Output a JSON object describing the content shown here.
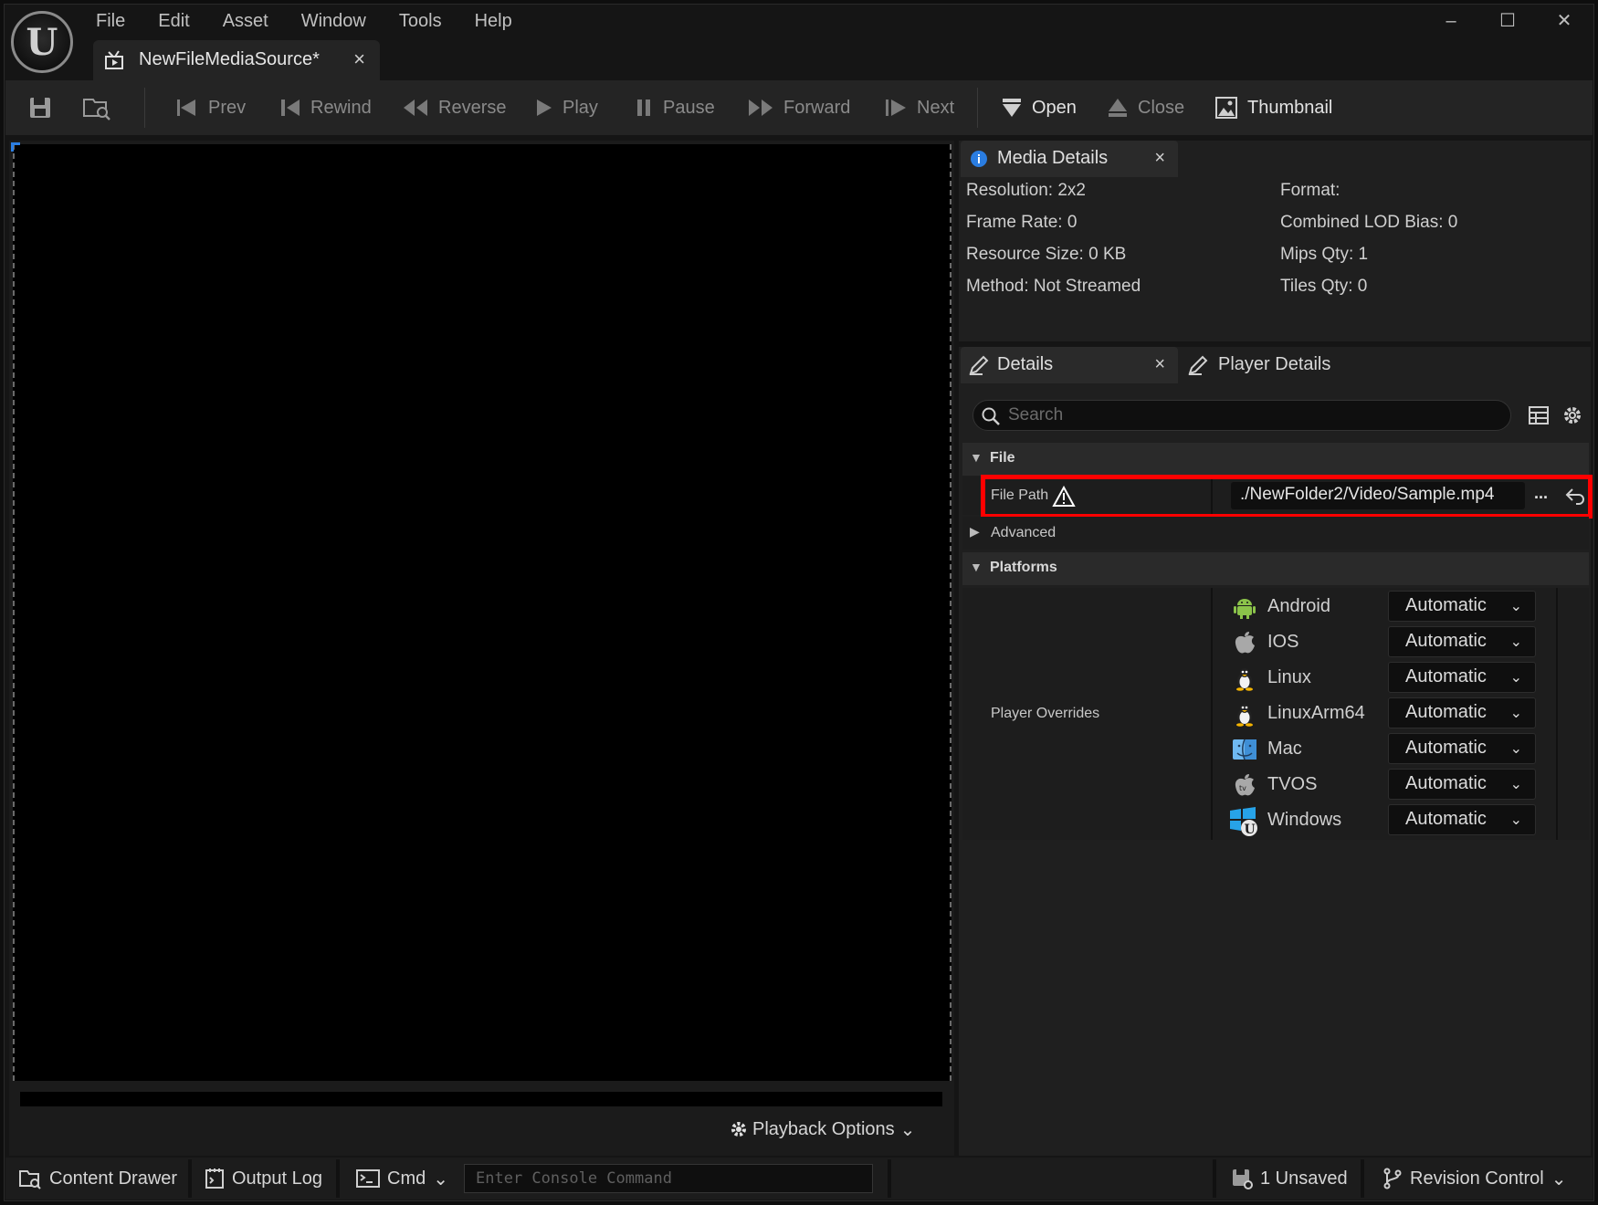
{
  "menu": [
    "File",
    "Edit",
    "Asset",
    "Window",
    "Tools",
    "Help"
  ],
  "document_tab": {
    "label": "NewFileMediaSource*",
    "close": "×"
  },
  "window_controls": {
    "minimize": "–",
    "maximize": "☐",
    "close": "✕"
  },
  "toolbar": {
    "prev": "Prev",
    "rewind": "Rewind",
    "reverse": "Reverse",
    "play": "Play",
    "pause": "Pause",
    "forward": "Forward",
    "next": "Next",
    "open": "Open",
    "close": "Close",
    "thumbnail": "Thumbnail"
  },
  "viewport": {
    "playback_options": "Playback Options"
  },
  "media_details": {
    "tab": "Media Details",
    "left": [
      "Resolution: 2x2",
      "Frame Rate: 0",
      "Resource Size: 0 KB",
      "Method: Not Streamed"
    ],
    "right": [
      "Format:",
      "Combined LOD Bias: 0",
      "Mips Qty: 1",
      "Tiles Qty: 0"
    ]
  },
  "details": {
    "tab": "Details",
    "player_tab": "Player Details",
    "search_placeholder": "Search",
    "file_category": "File",
    "file_path_label": "File Path",
    "file_path_value": "./NewFolder2/Video/Sample.mp4",
    "browse": "...",
    "advanced": "Advanced",
    "platforms_category": "Platforms",
    "player_overrides": "Player Overrides",
    "platforms": [
      {
        "name": "Android",
        "value": "Automatic"
      },
      {
        "name": "IOS",
        "value": "Automatic"
      },
      {
        "name": "Linux",
        "value": "Automatic"
      },
      {
        "name": "LinuxArm64",
        "value": "Automatic"
      },
      {
        "name": "Mac",
        "value": "Automatic"
      },
      {
        "name": "TVOS",
        "value": "Automatic"
      },
      {
        "name": "Windows",
        "value": "Automatic"
      }
    ]
  },
  "statusbar": {
    "content_drawer": "Content Drawer",
    "output_log": "Output Log",
    "cmd": "Cmd",
    "console_placeholder": "Enter Console Command",
    "unsaved": "1 Unsaved",
    "revision_control": "Revision Control"
  },
  "colors": {
    "highlight": "#ff0000",
    "accent": "#2a7de1",
    "bg": "#151515"
  }
}
